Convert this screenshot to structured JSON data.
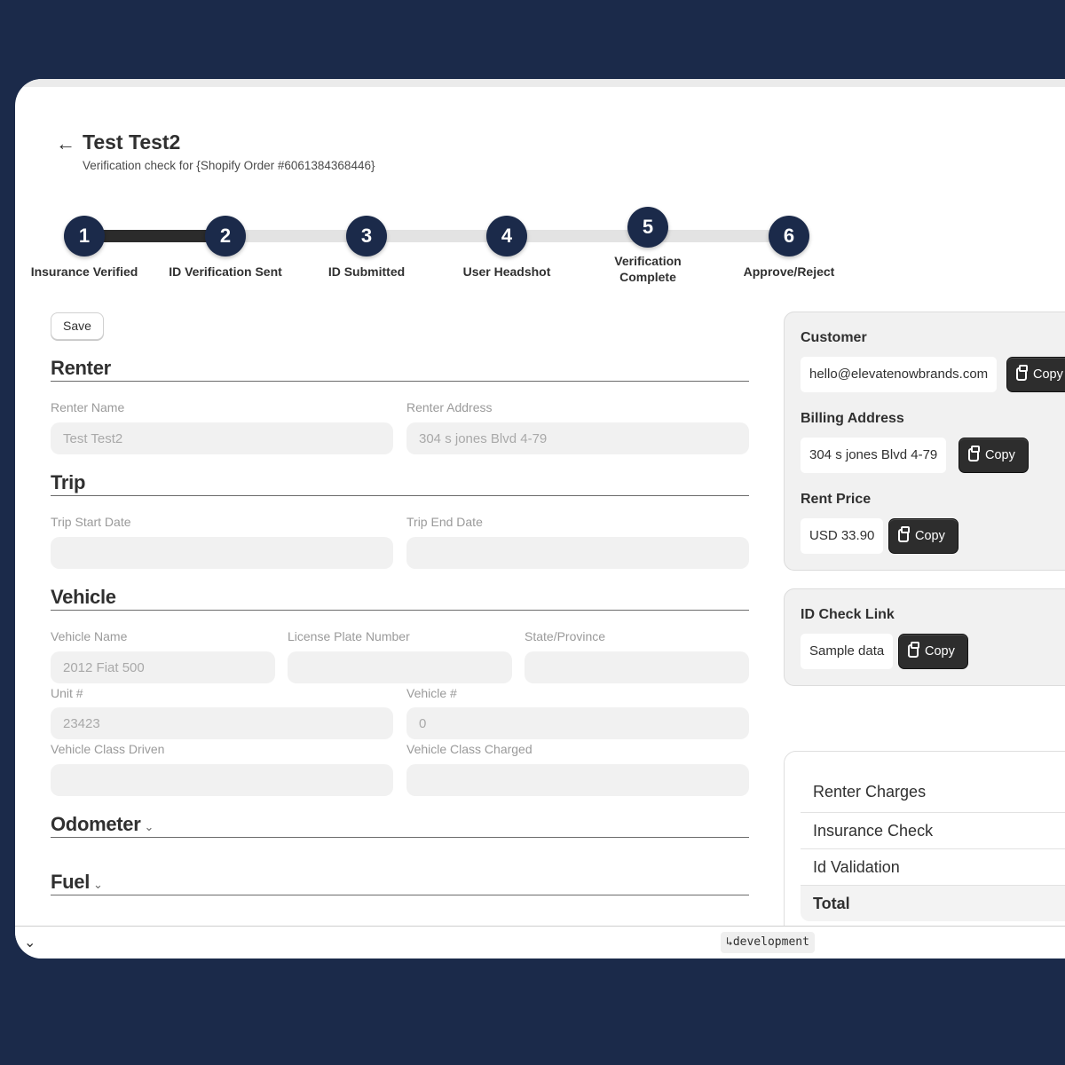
{
  "header": {
    "back_icon": "arrow-left-icon",
    "title": "Test Test2",
    "subtitle": "Verification check for {Shopify Order #6061384368446}"
  },
  "stepper": {
    "completed_through_step": 2,
    "steps": [
      {
        "number": "1",
        "label": "Insurance Verified"
      },
      {
        "number": "2",
        "label": "ID Verification Sent"
      },
      {
        "number": "3",
        "label": "ID Submitted"
      },
      {
        "number": "4",
        "label": "User Headshot"
      },
      {
        "number": "5",
        "label": "Verification Complete"
      },
      {
        "number": "6",
        "label": "Approve/Reject"
      }
    ]
  },
  "toolbar": {
    "save_label": "Save"
  },
  "sections": {
    "renter": {
      "title": "Renter",
      "renter_name": {
        "label": "Renter Name",
        "value": "Test Test2"
      },
      "renter_address": {
        "label": "Renter Address",
        "value": "304 s jones Blvd 4-79"
      }
    },
    "trip": {
      "title": "Trip",
      "start_date": {
        "label": "Trip Start Date",
        "value": ""
      },
      "end_date": {
        "label": "Trip End Date",
        "value": ""
      }
    },
    "vehicle": {
      "title": "Vehicle",
      "vehicle_name": {
        "label": "Vehicle Name",
        "value": "2012 Fiat 500"
      },
      "license_plate": {
        "label": "License Plate Number",
        "value": ""
      },
      "state": {
        "label": "State/Province",
        "value": ""
      },
      "unit": {
        "label": "Unit #",
        "value": "23423"
      },
      "vehicle_number": {
        "label": "Vehicle #",
        "value": "0"
      },
      "class_driven": {
        "label": "Vehicle Class Driven",
        "value": ""
      },
      "class_charged": {
        "label": "Vehicle Class Charged",
        "value": ""
      }
    },
    "odometer": {
      "title": "Odometer",
      "chevron": "⌄"
    },
    "fuel": {
      "title": "Fuel",
      "chevron": "⌄"
    }
  },
  "sidebar": {
    "copy_label": "Copy",
    "customer": {
      "label": "Customer",
      "value": "hello@elevatenowbrands.com"
    },
    "billing": {
      "label": "Billing Address",
      "value": "304 s jones Blvd 4-79"
    },
    "rent_price": {
      "label": "Rent Price",
      "value": "USD 33.90"
    },
    "id_check": {
      "label": "ID Check Link",
      "value": "Sample data"
    },
    "charges": {
      "header": "Renter Charges",
      "rows": [
        "Insurance Check",
        "Id Validation"
      ],
      "total_label": "Total"
    }
  },
  "bottom_bar": {
    "chevron": "⌄",
    "branch": "↳development"
  },
  "colors": {
    "brand_navy": "#1b2a4a",
    "button_dark": "#2d2d2d",
    "input_bg": "#f1f1f1"
  }
}
